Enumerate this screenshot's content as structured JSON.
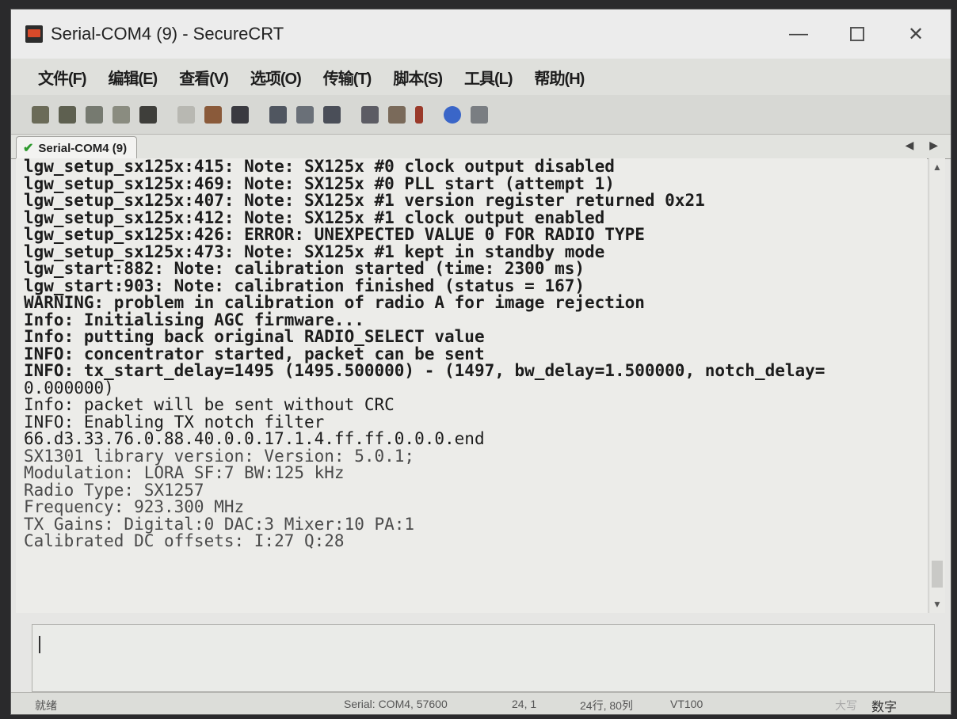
{
  "window": {
    "title": "Serial-COM4 (9) - SecureCRT"
  },
  "controls": {
    "minimize": "—",
    "close": "✕"
  },
  "menu": [
    "文件(F)",
    "编辑(E)",
    "查看(V)",
    "选项(O)",
    "传输(T)",
    "脚本(S)",
    "工具(L)",
    "帮助(H)"
  ],
  "toolbar": {
    "icons": [
      "connect-icon",
      "quick-connect-icon",
      "connect-tab-icon",
      "reconnect-icon",
      "disconnect-icon",
      "copy-icon",
      "paste-icon",
      "find-icon",
      "print-icon",
      "print-selection-icon",
      "print-setup-icon",
      "session-options-icon",
      "global-options-icon",
      "keymap-icon",
      "help-icon",
      "properties-icon"
    ]
  },
  "tab": {
    "label": "Serial-COM4 (9)",
    "nav": "◀ ▶"
  },
  "terminal": {
    "lines": [
      "lgw_setup_sx125x:415: Note: SX125x #0 clock output disabled",
      "lgw_setup_sx125x:469: Note: SX125x #0 PLL start (attempt 1)",
      "lgw_setup_sx125x:407: Note: SX125x #1 version register returned 0x21",
      "lgw_setup_sx125x:412: Note: SX125x #1 clock output enabled",
      "lgw_setup_sx125x:426: ERROR: UNEXPECTED VALUE 0 FOR RADIO TYPE",
      "lgw_setup_sx125x:473: Note: SX125x #1 kept in standby mode",
      "lgw_start:882: Note: calibration started (time: 2300 ms)",
      "lgw_start:903: Note: calibration finished (status = 167)",
      "WARNING: problem in calibration of radio A for image rejection",
      "Info: Initialising AGC firmware...",
      "Info: putting back original RADIO_SELECT value",
      "INFO: concentrator started, packet can be sent",
      "INFO: tx_start_delay=1495 (1495.500000) - (1497, bw_delay=1.500000, notch_delay=",
      "0.000000)",
      "Info: packet will be sent without CRC",
      "INFO: Enabling TX notch filter",
      "66.d3.33.76.0.88.40.0.0.17.1.4.ff.ff.0.0.0.end",
      "SX1301 library version: Version: 5.0.1;",
      "Modulation: LORA SF:7 BW:125 kHz",
      "Radio Type: SX1257",
      "Frequency: 923.300 MHz",
      "TX Gains: Digital:0 DAC:3 Mixer:10 PA:1",
      "Calibrated DC offsets: I:27 Q:28"
    ]
  },
  "status": {
    "ready": "就绪",
    "connection": "Serial: COM4, 57600",
    "cursor": "24,  1",
    "size": "24行, 80列",
    "emulation": "VT100",
    "caps": "大写",
    "num": "数字"
  }
}
